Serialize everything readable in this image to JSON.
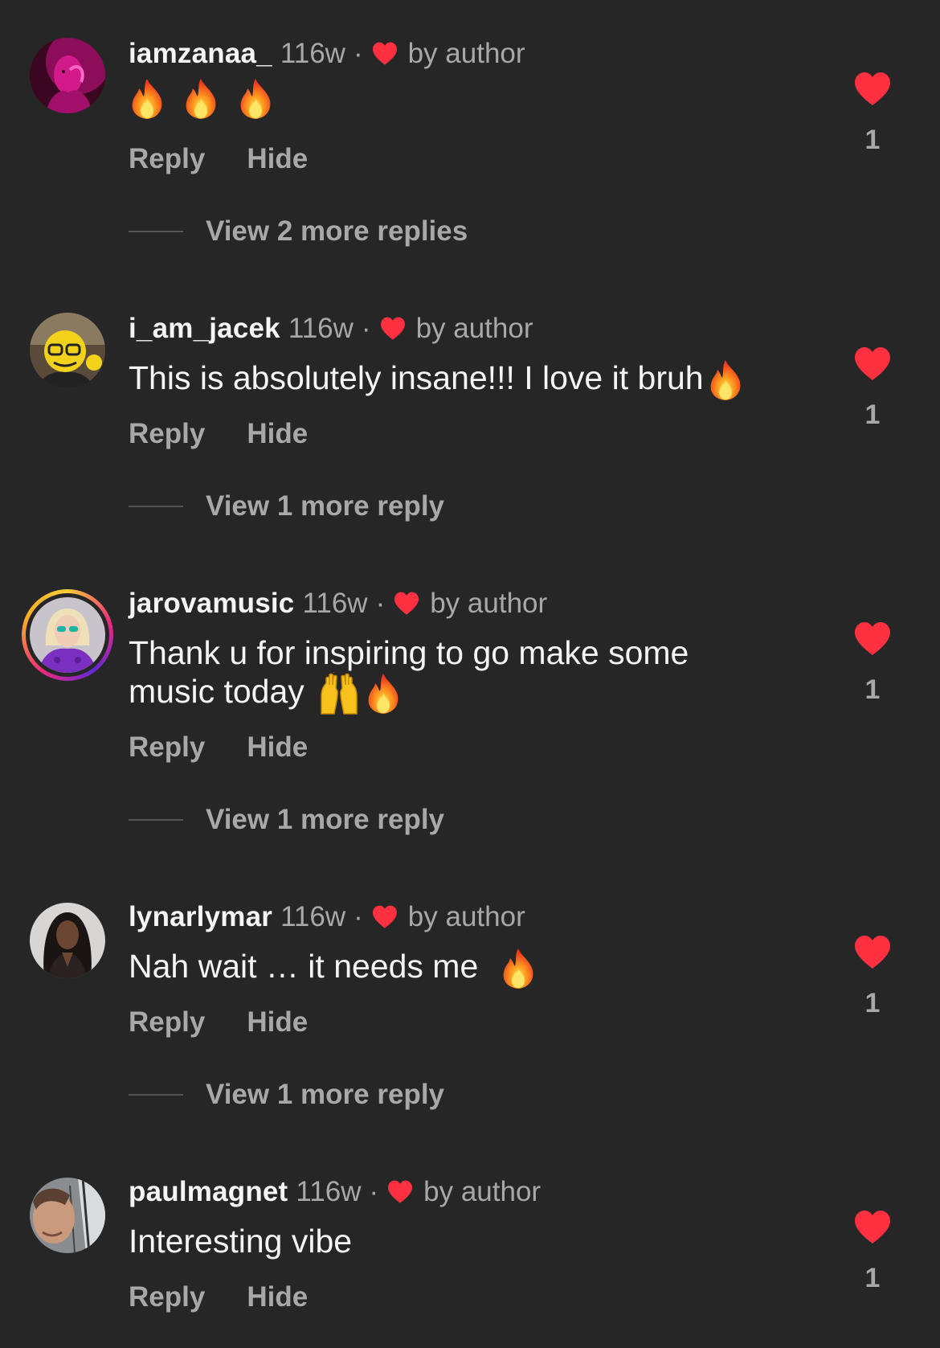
{
  "colors": {
    "background": "#262626",
    "primary_text": "#f5f5f5",
    "secondary_text": "#a8a8a8",
    "heart_red": "#ff3040"
  },
  "comments": [
    {
      "username": "iamzanaa_",
      "age": "116w",
      "separator": "·",
      "liked_by": "by author",
      "text": "",
      "emojis": [
        "fire-icon",
        "fire-icon",
        "fire-icon"
      ],
      "reply_label": "Reply",
      "hide_label": "Hide",
      "like_count": "1",
      "view_replies": "View 2 more replies",
      "avatar": "pink-portrait-avatar"
    },
    {
      "username": "i_am_jacek",
      "age": "116w",
      "separator": "·",
      "liked_by": "by author",
      "text": "This is absolutely insane!!! I love it bruh",
      "emojis": [
        "fire-icon"
      ],
      "reply_label": "Reply",
      "hide_label": "Hide",
      "like_count": "1",
      "view_replies": "View 1 more reply",
      "avatar": "yellow-glasses-avatar"
    },
    {
      "username": "jarovamusic",
      "age": "116w",
      "separator": "·",
      "liked_by": "by author",
      "text_line1": "Thank u for inspiring to go make some",
      "text_line2": "music today",
      "emojis": [
        "raising-hands-icon",
        "fire-icon"
      ],
      "reply_label": "Reply",
      "hide_label": "Hide",
      "like_count": "1",
      "view_replies": "View 1 more reply",
      "avatar": "purple-blonde-avatar",
      "has_story_ring": true
    },
    {
      "username": "lynarlymar",
      "age": "116w",
      "separator": "·",
      "liked_by": "by author",
      "text": "Nah wait … it needs me",
      "emojis": [
        "fire-icon"
      ],
      "reply_label": "Reply",
      "hide_label": "Hide",
      "like_count": "1",
      "view_replies": "View 1 more reply",
      "avatar": "dark-hair-avatar"
    },
    {
      "username": "paulmagnet",
      "age": "116w",
      "separator": "·",
      "liked_by": "by author",
      "text": "Interesting vibe",
      "emojis": [],
      "reply_label": "Reply",
      "hide_label": "Hide",
      "like_count": "1",
      "avatar": "car-selfie-avatar"
    }
  ]
}
